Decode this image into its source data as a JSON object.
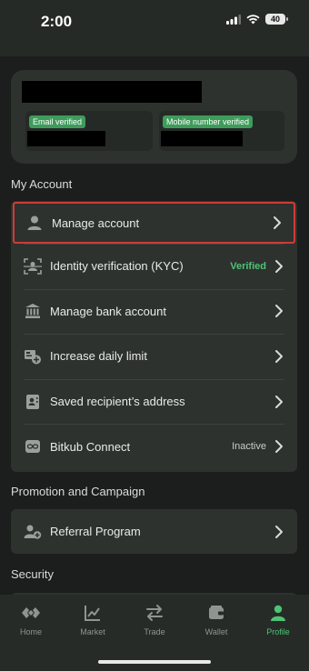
{
  "status_bar": {
    "time": "2:00",
    "battery": "40"
  },
  "profile": {
    "badges": {
      "email": "Email verified",
      "mobile": "Mobile number verified"
    }
  },
  "my_account": {
    "title": "My Account",
    "items": [
      {
        "label": "Manage account",
        "icon": "person-icon",
        "status": ""
      },
      {
        "label": "Identity verification (KYC)",
        "icon": "id-scan-icon",
        "status": "Verified"
      },
      {
        "label": "Manage bank account",
        "icon": "bank-icon",
        "status": ""
      },
      {
        "label": "Increase daily limit",
        "icon": "limit-icon",
        "status": ""
      },
      {
        "label": "Saved recipient’s address",
        "icon": "contact-card-icon",
        "status": ""
      },
      {
        "label": "Bitkub Connect",
        "icon": "chain-link-icon",
        "status": "Inactive"
      }
    ]
  },
  "promotion": {
    "title": "Promotion and Campaign",
    "items": [
      {
        "label": "Referral Program",
        "icon": "referral-icon"
      }
    ]
  },
  "security": {
    "title": "Security"
  },
  "tabbar": {
    "tabs": [
      {
        "label": "Home",
        "icon": "home-logo-icon"
      },
      {
        "label": "Market",
        "icon": "chart-icon"
      },
      {
        "label": "Trade",
        "icon": "swap-arrows-icon"
      },
      {
        "label": "Wallet",
        "icon": "wallet-icon"
      },
      {
        "label": "Profile",
        "icon": "profile-icon",
        "active": true
      }
    ]
  },
  "colors": {
    "accent": "#4fc374",
    "highlight_border": "#d23a35",
    "background": "#1b1e1c",
    "card": "#2d322f"
  }
}
